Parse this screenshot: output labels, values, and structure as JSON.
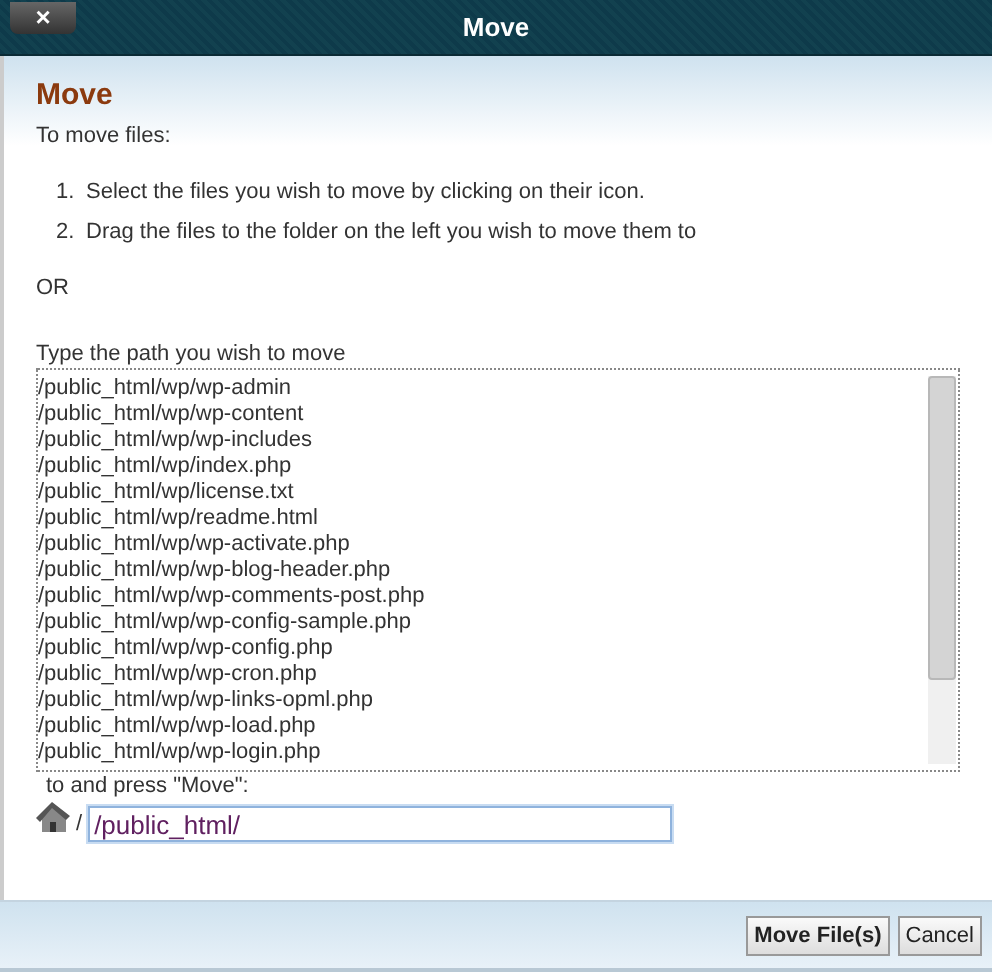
{
  "window": {
    "title": "Move",
    "close_label": "×"
  },
  "heading": "Move",
  "intro": "To move files:",
  "steps": [
    {
      "number": "1.",
      "text": "Select the files you wish to move by clicking on their icon."
    },
    {
      "number": "2.",
      "text": "Drag the files to the folder on the left you wish to move them to"
    }
  ],
  "or": "OR",
  "path_prompt": "Type the path you wish to move",
  "files": [
    "/public_html/wp/wp-admin",
    "/public_html/wp/wp-content",
    "/public_html/wp/wp-includes",
    "/public_html/wp/index.php",
    "/public_html/wp/license.txt",
    "/public_html/wp/readme.html",
    "/public_html/wp/wp-activate.php",
    "/public_html/wp/wp-blog-header.php",
    "/public_html/wp/wp-comments-post.php",
    "/public_html/wp/wp-config-sample.php",
    "/public_html/wp/wp-config.php",
    "/public_html/wp/wp-cron.php",
    "/public_html/wp/wp-links-opml.php",
    "/public_html/wp/wp-load.php",
    "/public_html/wp/wp-login.php"
  ],
  "destination_prompt": "to and press \"Move\":",
  "path_prefix": "/",
  "destination": {
    "value": "/public_html/"
  },
  "buttons": [
    {
      "label": "Move File(s)",
      "kind": "primary"
    },
    {
      "label": "Cancel",
      "kind": "secondary"
    }
  ]
}
